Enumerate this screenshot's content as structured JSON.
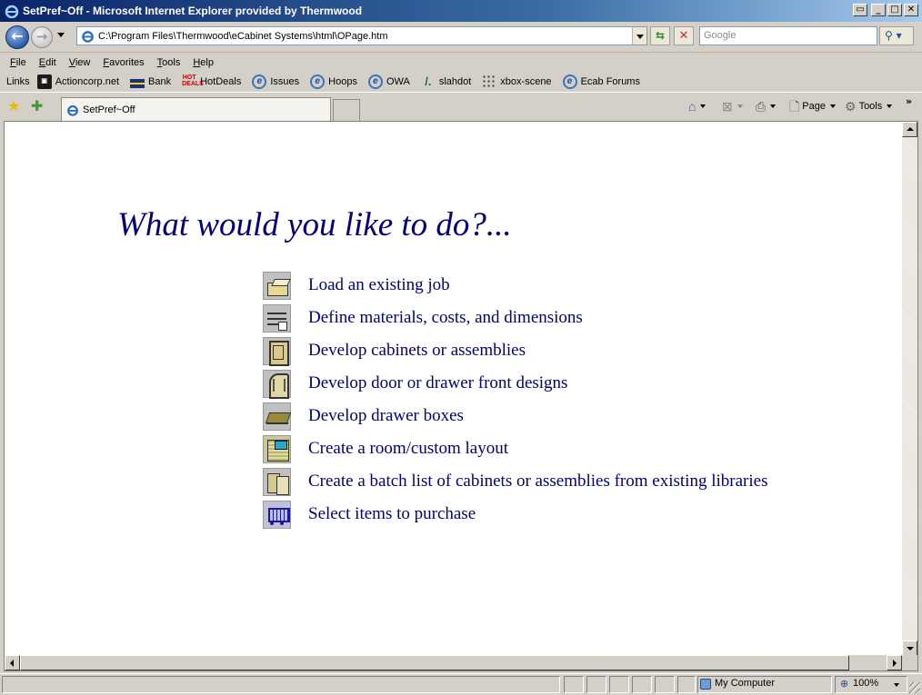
{
  "window": {
    "title": "SetPref~Off - Microsoft Internet Explorer provided by Thermwood"
  },
  "navbar": {
    "address": "C:\\Program Files\\Thermwood\\eCabinet Systems\\html\\OPage.htm",
    "search_placeholder": "Google"
  },
  "menu": {
    "items": [
      {
        "u": "F",
        "rest": "ile"
      },
      {
        "u": "E",
        "rest": "dit"
      },
      {
        "u": "V",
        "rest": "iew"
      },
      {
        "u": "F",
        "rest": "avorites",
        "prefix": ""
      },
      {
        "u": "T",
        "rest": "ools"
      },
      {
        "u": "H",
        "rest": "elp"
      }
    ]
  },
  "links": {
    "label": "Links",
    "items": [
      "Actioncorp.net",
      "Bank",
      "HotDeals",
      "Issues",
      "Hoops",
      "OWA",
      "slahdot",
      "xbox-scene",
      "Ecab Forums"
    ],
    "hot_icon_text": "HOT DEALS"
  },
  "tabs": {
    "active_title": "SetPref~Off"
  },
  "commands": {
    "page": "Page",
    "tools": "Tools",
    "chevron": "»"
  },
  "content": {
    "heading": "What would you like to do?...",
    "tasks": [
      "Load an existing job",
      "Define materials, costs, and dimensions",
      "Develop cabinets or assemblies",
      "Develop door or drawer front designs",
      "Develop drawer boxes",
      "Create a room/custom layout",
      "Create a batch list of cabinets or assemblies from existing libraries",
      "Select items to purchase"
    ]
  },
  "statusbar": {
    "zone": "My Computer",
    "zoom": "100%"
  },
  "colors": {
    "heading": "#000080",
    "titlebar_start": "#0a246a",
    "chrome": "#d4d0c8"
  }
}
